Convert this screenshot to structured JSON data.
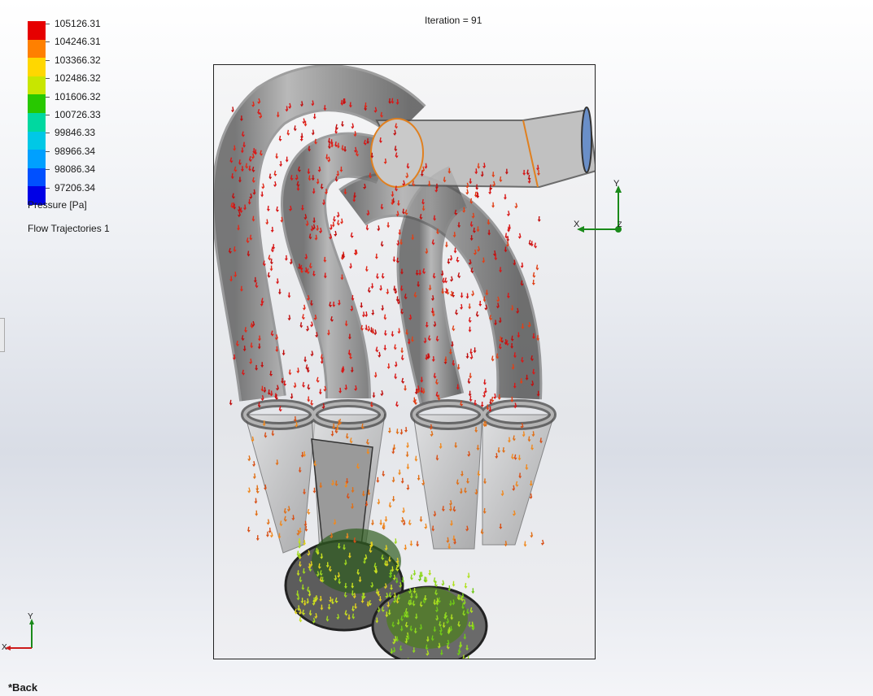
{
  "iteration_label": "Iteration = 91",
  "legend": {
    "colors": [
      "#e60000",
      "#ff8000",
      "#ffd700",
      "#c8e600",
      "#28c800",
      "#00d8a0",
      "#00c8e6",
      "#00a0ff",
      "#0050ff",
      "#0000e6"
    ],
    "values": [
      "105126.31",
      "104246.31",
      "103366.32",
      "102486.32",
      "101606.32",
      "100726.33",
      "99846.33",
      "98966.34",
      "98086.34",
      "97206.34"
    ],
    "title": "Pressure [Pa]",
    "subtitle": "Flow Trajectories 1"
  },
  "triad_view": {
    "y": "Y",
    "x": "X",
    "z": "Z"
  },
  "triad_corner": {
    "y": "Y",
    "x": "X"
  },
  "back_label": "*Back"
}
